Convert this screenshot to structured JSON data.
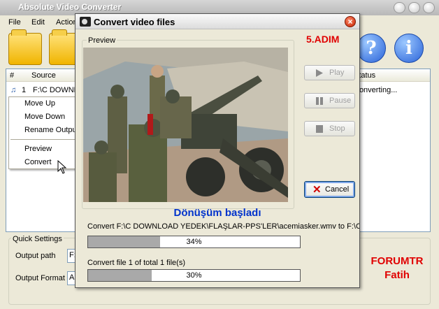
{
  "main": {
    "title": "Absolute Video Converter",
    "menu": {
      "file": "File",
      "edit": "Edit",
      "action": "Action"
    },
    "grid": {
      "col_num": "#",
      "col_source": "Source",
      "col_status": "Status",
      "row_index": "1",
      "row_source": "F:\\C DOWNL",
      "row_status": "Converting..."
    },
    "quick_settings": {
      "title": "Quick Settings",
      "output_path_label": "Output path",
      "output_path_value": "F:",
      "output_format_label": "Output Format",
      "output_format_value": "A"
    }
  },
  "context_menu": {
    "move_up": "Move Up",
    "move_down": "Move Down",
    "rename": "Rename Output File",
    "preview": "Preview",
    "convert": "Convert"
  },
  "dialog": {
    "title": "Convert video files",
    "step": "5.ADIM",
    "preview_label": "Preview",
    "play": "Play",
    "pause": "Pause",
    "stop": "Stop",
    "cancel": "Cancel",
    "status": "Dönüşüm başladı",
    "convert_line": "Convert F:\\C DOWNLOAD YEDEK\\FLAŞLAR-PPS'LER\\acemiasker.wmv to F:\\C",
    "progress1_text": "34%",
    "progress1_value": 0.34,
    "file_line": "Convert file 1 of total 1 file(s)",
    "progress2_text": "30%",
    "progress2_value": 0.3
  },
  "brand": {
    "line1": "FORUMTR",
    "line2": "Fatih"
  }
}
